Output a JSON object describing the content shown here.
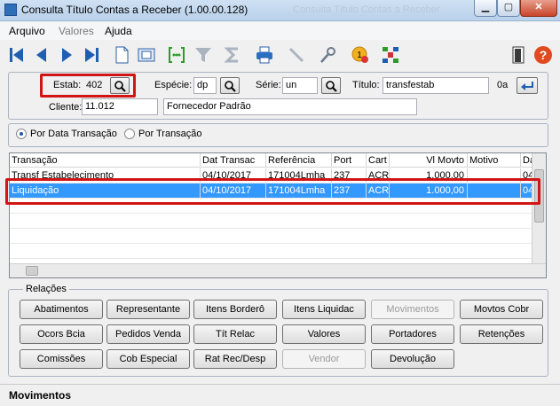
{
  "window": {
    "title": "Consulta Título Contas a Receber (1.00.00.128)",
    "ghost_title": "Consulta Título Contas a Receber",
    "min_glyph": "▁",
    "max_glyph": "▢",
    "close_glyph": "✕"
  },
  "menu": {
    "items": [
      "Arquivo",
      "Valores",
      "Ajuda"
    ]
  },
  "toolbar": {
    "icons": [
      "first-icon",
      "previous-icon",
      "next-icon",
      "last-icon",
      "new-document-icon",
      "view-icon",
      "goto-icon",
      "filter-icon",
      "sum-icon",
      "print-icon",
      "pen-icon",
      "search-key-icon",
      "info-icon",
      "tree-icon",
      "exit-icon",
      "help-icon"
    ],
    "help_glyph": "?"
  },
  "header": {
    "estab_label": "Estab:",
    "estab_value": "402",
    "especie_label": "Espécie:",
    "especie_value": "dp",
    "serie_label": "Série:",
    "serie_value": "un",
    "titulo_label": "Título:",
    "titulo_value": "transfestab",
    "parcela_value": "0a",
    "cliente_label": "Cliente:",
    "cliente_value": "11.012",
    "cliente_nome": "Fornecedor Padrão"
  },
  "filter": {
    "option1": "Por Data Transação",
    "option2": "Por Transação",
    "selected": "Por Data Transação"
  },
  "grid": {
    "columns": [
      "Transação",
      "Dat Transac",
      "Referência",
      "Port",
      "Cart",
      "Vl Movto",
      "Motivo",
      "Da"
    ],
    "rows": [
      [
        "Transf Estabelecimento",
        "04/10/2017",
        "171004Lmha",
        "237",
        "ACR",
        "1.000,00",
        "",
        "04"
      ],
      [
        "Liquidação",
        "04/10/2017",
        "171004Lmha",
        "237",
        "ACR",
        "1.000,00",
        "",
        "04"
      ]
    ],
    "selected_row": 1
  },
  "relacoes": {
    "title": "Relações",
    "buttons": [
      [
        "Abatimentos",
        "Representante",
        "Itens Borderô",
        "Itens Liquidac",
        "Movimentos",
        "Movtos Cobr"
      ],
      [
        "Ocors Bcia",
        "Pedidos Venda",
        "Tít Relac",
        "Valores",
        "Portadores",
        "Retenções"
      ],
      [
        "Comissões",
        "Cob Especial",
        "Rat Rec/Desp",
        "Vendor",
        "Devolução"
      ]
    ],
    "disabled": [
      "Movimentos",
      "Vendor"
    ]
  },
  "status": {
    "text": "Movimentos"
  },
  "colors": {
    "selection": "#3399ff",
    "highlight": "#d11414",
    "accent": "#1e5eb3"
  }
}
